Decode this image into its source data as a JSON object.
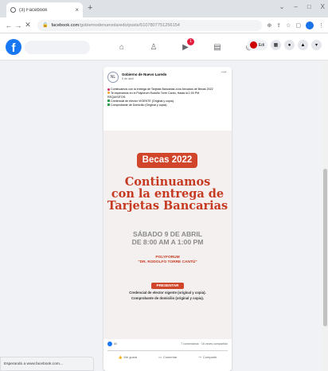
{
  "browser": {
    "tab": {
      "title": "(3) Facebook"
    },
    "win": {
      "minimize": "‒",
      "maximize": "□",
      "close": "X"
    },
    "url": {
      "domain": "facebook.com",
      "path": "/gobiernodenuevolaredo/posts/5107807751256154"
    },
    "status": "Esperando a www.facebook.com..."
  },
  "facebook": {
    "logo": "f",
    "notif_badge": "1",
    "user": "Edi"
  },
  "post": {
    "page_name": "Gobierno de Nuevo Laredo",
    "date": "5 de abril",
    "lines": [
      {
        "k": "red",
        "t": "Continuamos con la entrega de Tarjetas Bancarias a los becados de Becas 2022"
      },
      {
        "k": "orange",
        "t": "Te esperamos en el Polyforum Rodolfo Torre Cantú, Hasta la 1:00 PM"
      },
      {
        "k": "none",
        "t": "REQUISITOS:"
      },
      {
        "k": "green",
        "t": "Credencial de elector VIGENTE (Original y copia)."
      },
      {
        "k": "green",
        "t": "Comprobante de Domicilio (Original y copia)."
      }
    ],
    "flyer": {
      "badge": "Becas 2022",
      "headline": [
        "Continuamos",
        "con la entrega de",
        "Tarjetas Bancarias"
      ],
      "date": [
        "SÁBADO 9 DE ABRIL",
        "DE 8:00 AM A 1:00 PM"
      ],
      "place": [
        "POLYFORUM",
        "\"DR. RODOLFO TORRE CANTÚ\""
      ],
      "present": "PRESENTAR",
      "reqs": [
        "Credencial de elector vigente (original y copia).",
        "Comprobante de domicilio (original y copia)."
      ]
    },
    "likes": "80",
    "stats": "7 comentarios · 16 veces compartido",
    "actions": {
      "like": "Me gusta",
      "comment": "Comentar",
      "share": "Compartir"
    }
  }
}
